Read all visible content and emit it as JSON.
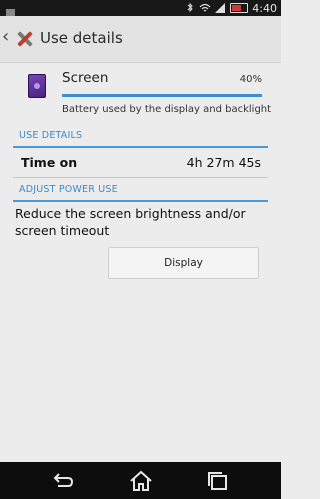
{
  "status_bar": {
    "time": "4:40"
  },
  "action_bar": {
    "title": "Use details"
  },
  "app_usage": {
    "name": "Screen",
    "percent_label": "40%",
    "percent_value": 40,
    "description": "Battery used by the display and backlight"
  },
  "use_details": {
    "header": "USE DETAILS",
    "time_on_label": "Time on",
    "time_on_value": "4h 27m 45s"
  },
  "adjust_power": {
    "header": "ADJUST POWER USE",
    "description": "Reduce the screen brightness and/or screen timeout",
    "button_label": "Display"
  },
  "colors": {
    "accent": "#3a8bd0",
    "action_bar": "#e3e3e3",
    "background": "#ececec",
    "nav_bar": "#0d0d0d"
  },
  "icons": {
    "back": "chevron-left-icon",
    "app": "settings-tools-icon",
    "screen": "screen-icon",
    "nav_back": "back-arrow-icon",
    "nav_home": "home-icon",
    "nav_recents": "recent-apps-icon"
  }
}
